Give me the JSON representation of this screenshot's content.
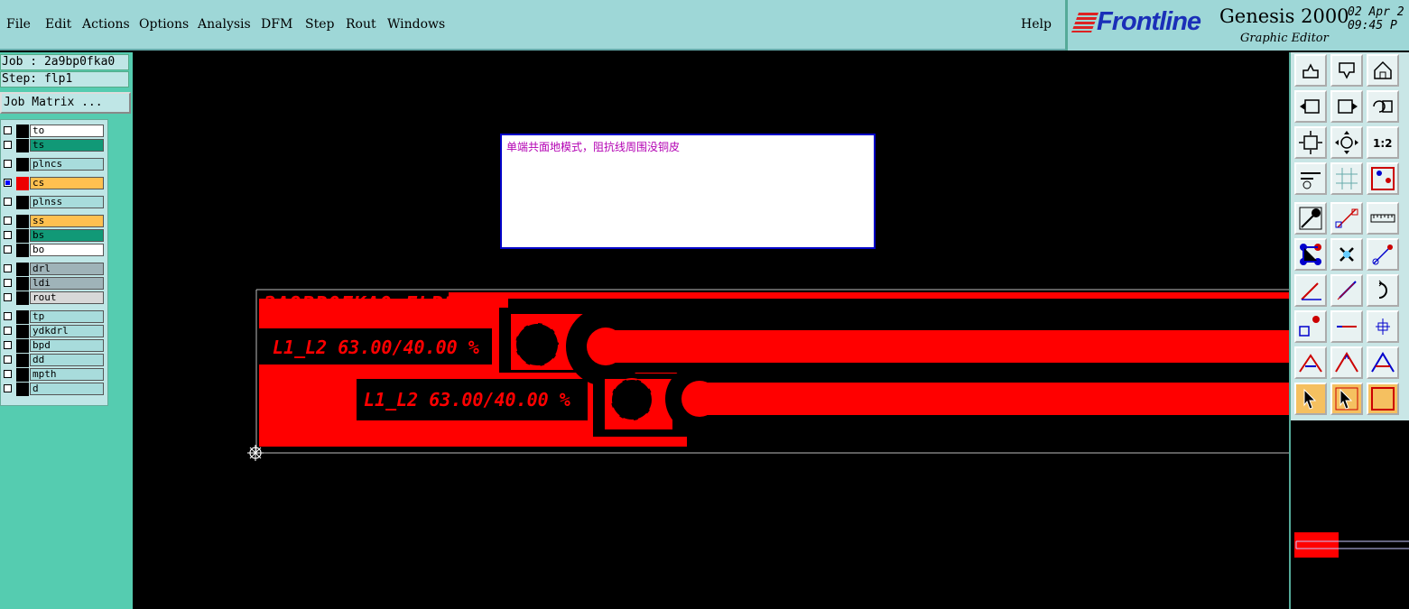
{
  "menu": {
    "file": "File",
    "edit": "Edit",
    "actions": "Actions",
    "options": "Options",
    "analysis": "Analysis",
    "dfm": "DFM",
    "step": "Step",
    "rout": "Rout",
    "windows": "Windows",
    "help": "Help"
  },
  "brand": {
    "logo": "Frontline",
    "title": "Genesis 2000",
    "subtitle": "Graphic Editor",
    "date": "02 Apr 2",
    "time": "09:45 P"
  },
  "job": {
    "job_label": "Job : 2a9bp0fka0",
    "step_label": "Step: flp1",
    "matrix_button": "Job Matrix ..."
  },
  "layers": [
    {
      "name": "to",
      "color": "#ffffff",
      "checked": false,
      "swatch": "#000000"
    },
    {
      "name": "ts",
      "color": "#119977",
      "checked": false,
      "swatch": "#000000"
    },
    {
      "name": "plncs",
      "color": "#a8dcdc",
      "checked": false,
      "swatch": "#000000"
    },
    {
      "name": "cs",
      "color": "#ffc050",
      "checked": true,
      "swatch": "#ee0000"
    },
    {
      "name": "plnss",
      "color": "#a8dcdc",
      "checked": false,
      "swatch": "#000000"
    },
    {
      "name": "ss",
      "color": "#ffc050",
      "checked": false,
      "swatch": "#000000"
    },
    {
      "name": "bs",
      "color": "#119977",
      "checked": false,
      "swatch": "#000000"
    },
    {
      "name": "bo",
      "color": "#ffffff",
      "checked": false,
      "swatch": "#000000"
    },
    {
      "name": "drl",
      "color": "#9fb3b8",
      "checked": false,
      "swatch": "#000000"
    },
    {
      "name": "ldi",
      "color": "#9fb3b8",
      "checked": false,
      "swatch": "#000000"
    },
    {
      "name": "rout",
      "color": "#d8d8d8",
      "checked": false,
      "swatch": "#000000"
    },
    {
      "name": "tp",
      "color": "#a8dcdc",
      "checked": false,
      "swatch": "#000000"
    },
    {
      "name": "ydkdrl",
      "color": "#a8dcdc",
      "checked": false,
      "swatch": "#000000"
    },
    {
      "name": "bpd",
      "color": "#a8dcdc",
      "checked": false,
      "swatch": "#000000"
    },
    {
      "name": "dd",
      "color": "#a8dcdc",
      "checked": false,
      "swatch": "#000000"
    },
    {
      "name": "mpth",
      "color": "#a8dcdc",
      "checked": false,
      "swatch": "#000000"
    },
    {
      "name": "d",
      "color": "#a8dcdc",
      "checked": false,
      "swatch": "#000000"
    }
  ],
  "note": {
    "text": "单端共面地模式，阻抗线周围没铜皮"
  },
  "board": {
    "title_text": "2A9BP0FKA0 FLP1",
    "label_1": "L1_L2 63.00/40.00 %",
    "label_2": "L1_L2 63.00/40.00 %",
    "copper_color": "#ff0000"
  },
  "toolbox": {
    "icons": [
      "move-up-icon",
      "move-down-icon",
      "home-icon",
      "move-left-icon",
      "move-right-icon",
      "undo-frame-icon",
      "zoom-fit-icon",
      "pan-icon",
      "scale-1-2-icon",
      "tools-icon",
      "grid-icon",
      "layer-select-icon",
      "feature-select-icon",
      "polygon-icon",
      "measure-icon",
      "connect-icon",
      "cross-icon",
      "line-icon",
      "angle-line-icon",
      "slant-line-icon",
      "arc-icon",
      "pad-icon",
      "h-line-icon",
      "dimension-icon",
      "triangle-icon",
      "text-a-icon",
      "text-a2-icon",
      "pointer-icon",
      "pointer-select-icon",
      "pointer-circle-icon"
    ]
  }
}
